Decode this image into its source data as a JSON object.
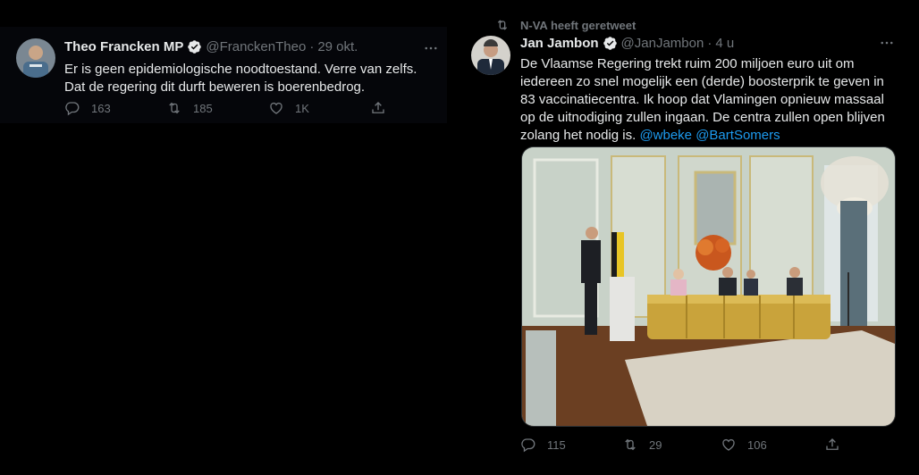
{
  "tweet1": {
    "author_name": "Theo Francken MP",
    "handle": "@FranckenTheo",
    "separator": "·",
    "time": "29 okt.",
    "text": "Er is geen epidemiologische noodtoestand. Verre van zelfs. Dat de regering dit durft beweren is boerenbedrog.",
    "replies": "163",
    "retweets": "185",
    "likes": "1K"
  },
  "tweet2": {
    "retweet_context": "N-VA heeft geretweet",
    "author_name": "Jan Jambon",
    "handle": "@JanJambon",
    "separator": "·",
    "time": "4 u",
    "text": "De Vlaamse Regering trekt ruim 200 miljoen euro uit om iedereen zo snel mogelijk een (derde) boosterprik te geven in 83 vaccinatiecentra. Ik hoop dat Vlamingen opnieuw massaal op de uitnodiging zullen ingaan. De centra zullen open blijven zolang het nodig is.",
    "mention1": "@wbeke",
    "mention2": "@BartSomers",
    "replies": "115",
    "retweets": "29",
    "likes": "106"
  },
  "colors": {
    "background": "#000000",
    "text": "#e7e9ea",
    "secondary": "#71767b",
    "accent": "#1d9bf0"
  },
  "icons": [
    "verified-icon",
    "more-icon",
    "reply-icon",
    "retweet-icon",
    "like-icon",
    "share-icon"
  ]
}
